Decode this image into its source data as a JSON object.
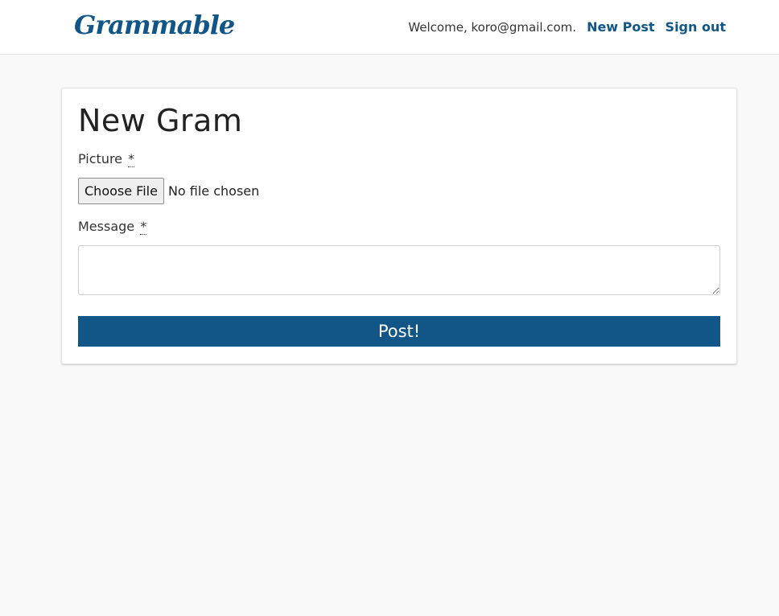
{
  "navbar": {
    "brand": "Grammable",
    "welcome": "Welcome, koro@gmail.com.",
    "new_post": "New Post",
    "sign_out": "Sign out"
  },
  "form": {
    "title": "New Gram",
    "picture_label": "Picture",
    "message_label": "Message",
    "required_marker": "*",
    "file_button": "Choose File",
    "file_status": "No file chosen",
    "message_value": "",
    "message_placeholder": "",
    "submit_label": "Post!"
  },
  "colors": {
    "brand": "#115686",
    "background": "#f9f9f9"
  }
}
